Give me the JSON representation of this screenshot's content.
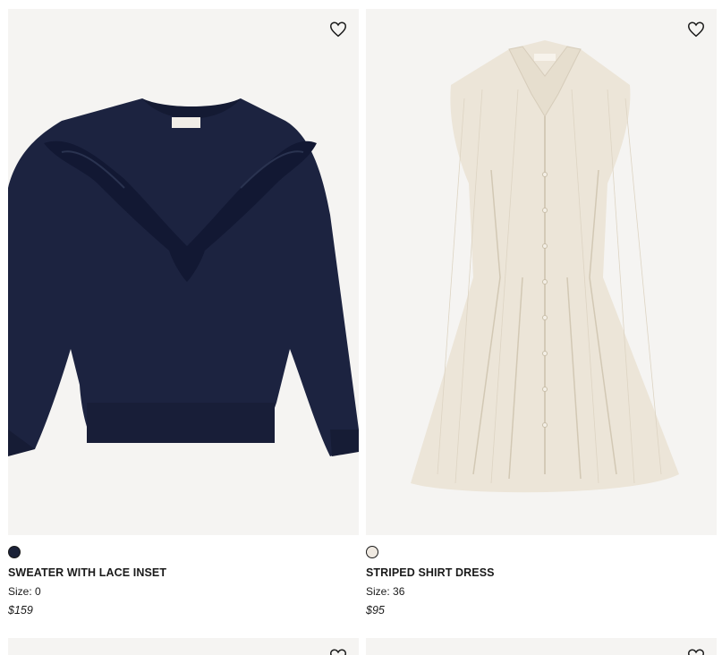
{
  "products": [
    {
      "name": "SWEATER WITH LACE INSET",
      "size_label": "Size:",
      "size_value": "0",
      "price": "$159",
      "swatch_color": "#1b2238",
      "image_icon": "navy-sweater-image",
      "wishlist_icon": "heart-outline-icon"
    },
    {
      "name": "STRIPED SHIRT DRESS",
      "size_label": "Size:",
      "size_value": "36",
      "price": "$95",
      "swatch_color": "#efe9e1",
      "image_icon": "striped-shirt-dress-image",
      "wishlist_icon": "heart-outline-icon"
    }
  ],
  "colors": {
    "image_bg": "#f5f4f2",
    "sweater": "#1c2340",
    "dress": "#ece5d8"
  }
}
